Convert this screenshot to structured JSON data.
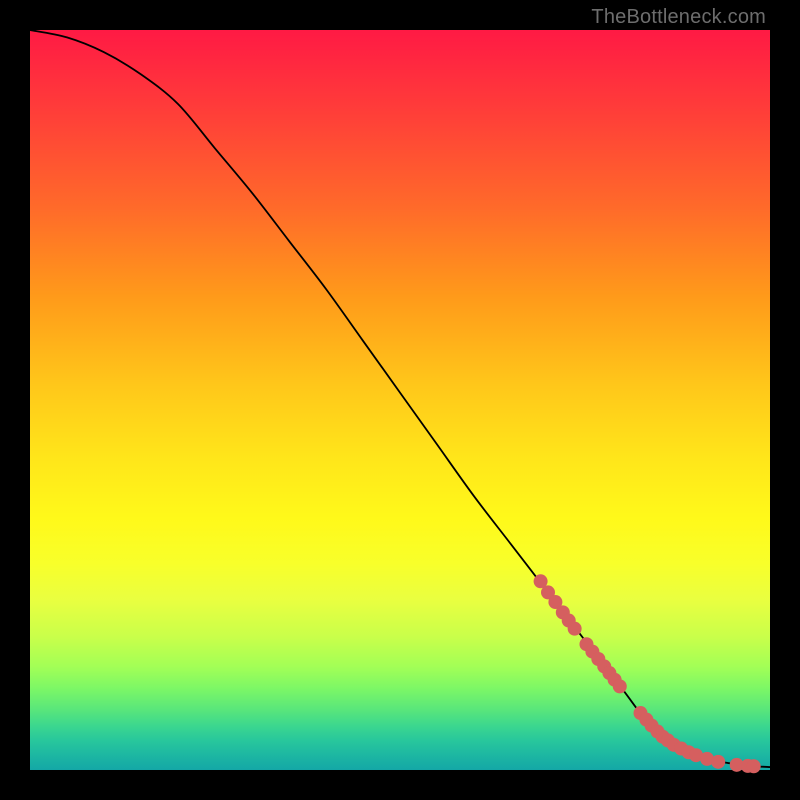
{
  "watermark": "TheBottleneck.com",
  "chart_data": {
    "type": "line",
    "title": "",
    "xlabel": "",
    "ylabel": "",
    "xlim": [
      0,
      100
    ],
    "ylim": [
      0,
      100
    ],
    "curve": {
      "name": "bottleneck-curve",
      "x": [
        0,
        5,
        10,
        15,
        20,
        25,
        30,
        35,
        40,
        45,
        50,
        55,
        60,
        65,
        70,
        75,
        80,
        83,
        85,
        88,
        90,
        92,
        94,
        96,
        98,
        100
      ],
      "y": [
        100,
        99,
        97,
        94,
        90,
        84,
        78,
        71.5,
        65,
        58,
        51,
        44,
        37,
        30.5,
        24,
        17.5,
        11,
        7,
        5,
        3.2,
        2.1,
        1.4,
        1.0,
        0.7,
        0.5,
        0.4
      ]
    },
    "markers": {
      "name": "highlight-points",
      "color": "#d55f5f",
      "radius_px": 7,
      "x": [
        69,
        70,
        71,
        72,
        72.8,
        73.6,
        75.2,
        76,
        76.8,
        77.6,
        78.3,
        79,
        79.7,
        82.5,
        83.3,
        84,
        84.8,
        85.5,
        86.2,
        87,
        88,
        89,
        90,
        91.5,
        93,
        95.5,
        97,
        97.8
      ],
      "y": [
        25.5,
        24,
        22.7,
        21.3,
        20.2,
        19.1,
        17,
        16,
        15,
        14,
        13.1,
        12.2,
        11.3,
        7.7,
        6.8,
        6.0,
        5.2,
        4.5,
        4.0,
        3.4,
        2.9,
        2.4,
        2.0,
        1.5,
        1.1,
        0.7,
        0.55,
        0.5
      ]
    }
  }
}
